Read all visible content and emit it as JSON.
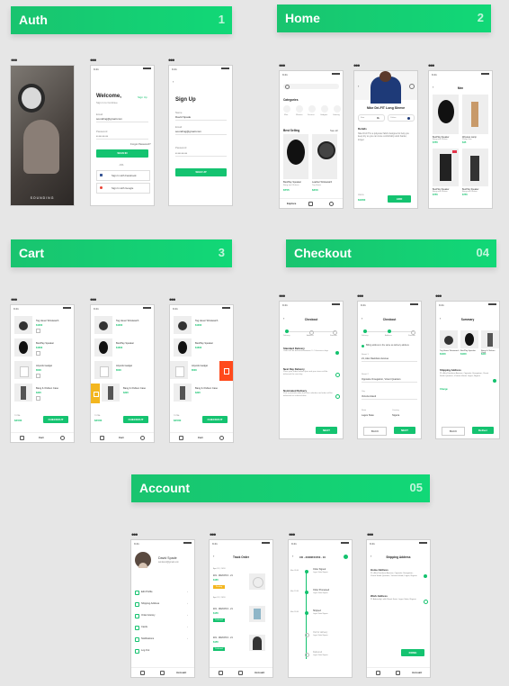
{
  "sections": {
    "auth": {
      "label": "Auth",
      "num": "1"
    },
    "home": {
      "label": "Home",
      "num": "2"
    },
    "cart": {
      "label": "Cart",
      "num": "3"
    },
    "checkout": {
      "label": "Checkout",
      "num": "04"
    },
    "account": {
      "label": "Account",
      "num": "05"
    }
  },
  "auth": {
    "splash_brand": "SOUNDING",
    "login": {
      "title": "Welcome,",
      "signup_link": "Sign Up",
      "subtitle": "Sign in to Continue",
      "email_label": "Email",
      "email_value": "sounding@gmail.com",
      "password_label": "Password",
      "password_value": "••••••••••",
      "forgot": "Forgot Password?",
      "button": "SIGN IN",
      "or": "-OR-",
      "facebook": "Sign In with Facebook",
      "google": "Sign In with Google"
    },
    "signup": {
      "title": "Sign Up",
      "name_label": "Name",
      "name_value": "David Spade",
      "email_label": "Email",
      "email_value": "sounding@gmail.com",
      "password_label": "Password",
      "password_value": "••••••••••",
      "button": "SIGN UP"
    }
  },
  "home": {
    "categories_label": "Categories",
    "category_items": [
      "Men",
      "Women",
      "Devices",
      "Gadgets",
      "Gaming"
    ],
    "best_selling": "Best Selling",
    "see_all": "See all",
    "products": [
      {
        "name": "BeoPlay Speaker",
        "brand": "Bang and Olufsen",
        "price": "$755"
      },
      {
        "name": "Leather Wristwatch",
        "brand": "Tag Heuer",
        "price": "$450"
      }
    ],
    "tabs": [
      "Explore",
      "Cart",
      "Account"
    ],
    "detail": {
      "title": "Nike Dri-FIT Long Sleeve",
      "size_label": "Size",
      "size_value": "XL",
      "color_label": "Colour",
      "details_label": "Details",
      "details_text": "Nike Dri-FIT is a polyester fabric designed to help you keep dry so you can more comfortably work harder, longer.",
      "price_label": "PRICE",
      "price": "$1800",
      "button": "ADD"
    },
    "wishlist": {
      "title": "Men",
      "items": [
        {
          "name": "BeoPlay Speaker",
          "brand": "Bang and Olufsen",
          "price": "$755"
        },
        {
          "name": "Wireless Lamp",
          "brand": "Philips Hue",
          "price": "$45"
        },
        {
          "name": "BeoPlay Speaker",
          "brand": "Bang and Olufsen",
          "price": "$755"
        },
        {
          "name": "BeoPlay Speaker",
          "brand": "Bang and Olufsen",
          "price": "$755"
        }
      ]
    }
  },
  "cart": {
    "items": [
      {
        "name": "Tag Heuer Wristwatch",
        "price": "$1000"
      },
      {
        "name": "BeoPlay Speaker",
        "price": "$1600"
      },
      {
        "name": "Airpods Gadget",
        "price": "$500"
      },
      {
        "name": "Bang & Olufsen Case",
        "price": "$320"
      }
    ],
    "total_label": "TOTAL",
    "total": "$4500",
    "button": "CHECKOUT",
    "tabs": [
      "Explore",
      "Cart",
      "Account"
    ]
  },
  "checkout": {
    "title": "Checkout",
    "summary_title": "Summary",
    "steps": [
      "Delivery",
      "Address",
      "Summer"
    ],
    "options": [
      {
        "name": "Standard Delivery",
        "desc": "Order will be delivered between 3 - 5 business days"
      },
      {
        "name": "Next Day Delivery",
        "desc": "Place your order before 6pm and your items will be delivered the next day"
      },
      {
        "name": "Nominated Delivery",
        "desc": "Pick a particular date from the calendar and order will be delivered on selected date"
      }
    ],
    "address_check": "Billing address is the same as delivery address",
    "street1_label": "Street 1",
    "street1_value": "21, Alex Davidson Avenue",
    "street2_label": "Street 2",
    "street2_value": "Opposite Omegatron, Vicent Quarters",
    "city_label": "City",
    "city_value": "Victoria Island",
    "state_label": "State",
    "state_value": "Lagos State",
    "country_label": "Country",
    "country_value": "Nigeria",
    "back": "BACK",
    "next": "NEXT",
    "deliver": "Deliver",
    "shipping_label": "Shipping Address",
    "shipping_text": "21, Alex Davidson Avenue, Opposite Omegatron, Vicent Smith Quarters, Victoria Island, Lagos, Nigeria",
    "change": "Change"
  },
  "account": {
    "name": "David Spade",
    "email": "iamdavid@gmail.com",
    "menu": [
      "Edit Profile",
      "Shipping Address",
      "Order History",
      "Cards",
      "Notifications",
      "Log Out"
    ],
    "track_title": "Track Order",
    "orders": [
      {
        "date": "April 12, 2018",
        "id": "#21 - 9D2CF5.6 - 21",
        "amount": "$165",
        "status": "Pending"
      },
      {
        "date": "April 12, 2018",
        "id": "#21 - 9D2CF5.6 - 21",
        "amount": "$155",
        "status": "Delivered"
      },
      {
        "date": "",
        "id": "#21 - 9D2CF5.6 - 21",
        "amount": "$155",
        "status": "Delivered"
      }
    ],
    "timeline_header": "CD - 3UD8PJ1553 - 10",
    "timeline": [
      {
        "time": "Mon 09:00",
        "label": "Order Signed",
        "sub": "Lagos State Nigeria"
      },
      {
        "time": "Mon 13:00",
        "label": "Order Processed",
        "sub": "Lagos State Nigeria"
      },
      {
        "time": "Mon 18:00",
        "label": "Shipped",
        "sub": "Lagos State Nigeria"
      },
      {
        "time": "",
        "label": "Out for delivery",
        "sub": "Lagos State Nigeria"
      },
      {
        "time": "",
        "label": "Delivered",
        "sub": "Lagos State Nigeria"
      }
    ],
    "ship_title": "Shipping Address",
    "home_label": "Home Address",
    "home_text": "21, Alex Davidson Avenue, Opposite Omegatron, Vicent Smith Quarters, Victoria Island, Lagos, Nigeria",
    "work_label": "Work Address",
    "work_text": "21 Admiralty Lekki Road, Ikate, Lagos State, Nigeria",
    "done": "DONE",
    "tabs": [
      "Explore",
      "Cart",
      "Account"
    ]
  },
  "colors": {
    "accent": "#13c26e",
    "background": "#e6e6e6",
    "pending": "#f3b61f",
    "delete": "#ff4a1c"
  }
}
